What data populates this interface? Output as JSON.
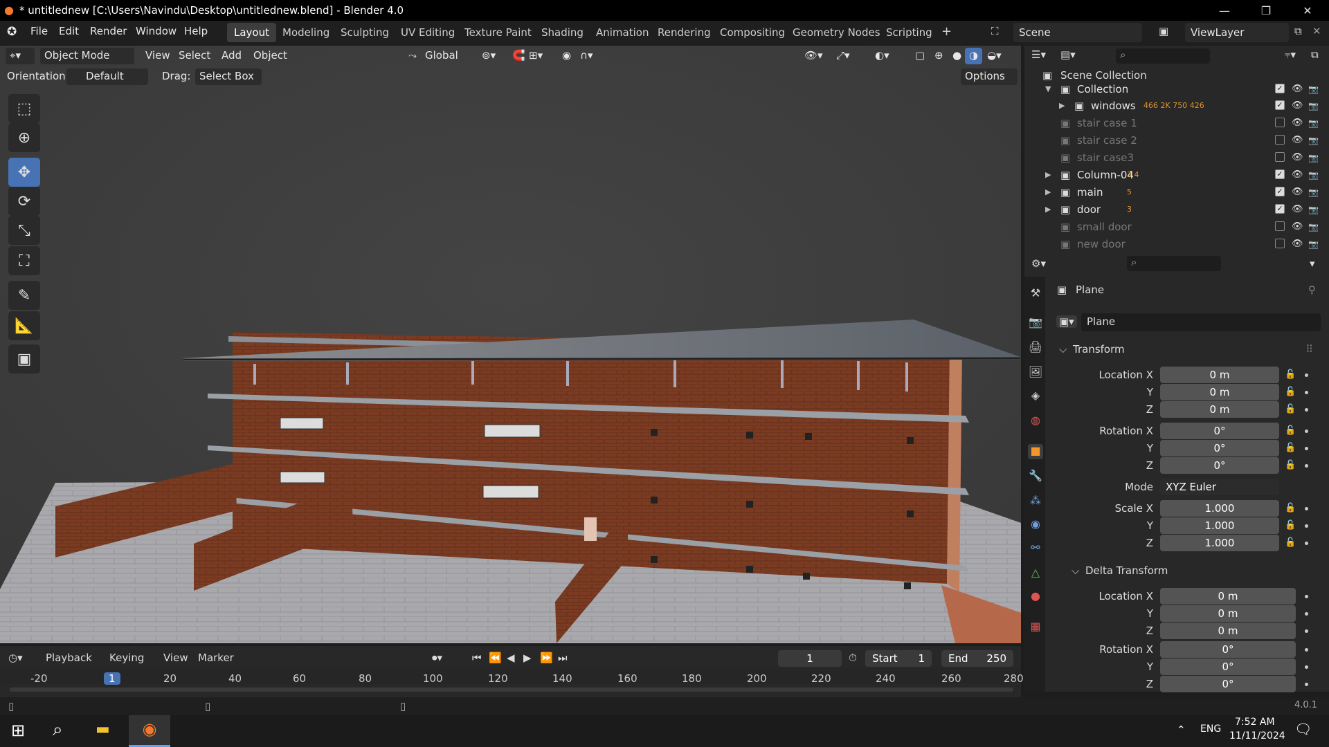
{
  "window": {
    "title": "* untitlednew [C:\\Users\\Navindu\\Desktop\\untitlednew.blend] - Blender 4.0",
    "minimize": "—",
    "maximize": "❐",
    "close": "✕"
  },
  "menu": {
    "file": "File",
    "edit": "Edit",
    "render": "Render",
    "window": "Window",
    "help": "Help"
  },
  "workspaces": [
    "Layout",
    "Modeling",
    "Sculpting",
    "UV Editing",
    "Texture Paint",
    "Shading",
    "Animation",
    "Rendering",
    "Compositing",
    "Geometry Nodes",
    "Scripting"
  ],
  "active_workspace": "Layout",
  "scene": {
    "name": "Scene",
    "view_layer": "ViewLayer"
  },
  "viewport_header": {
    "mode": "Object Mode",
    "view": "View",
    "select": "Select",
    "add": "Add",
    "object": "Object",
    "transform_orientation": "Global",
    "orientation_label": "Orientation:",
    "orientation_value": "Default",
    "drag_label": "Drag:",
    "drag_value": "Select Box",
    "options": "Options"
  },
  "outliner": {
    "root": "Scene Collection",
    "rows": [
      {
        "label": "Collection",
        "checked": true,
        "dim": false,
        "expanded": true
      },
      {
        "label": "windows",
        "checked": true,
        "dim": false,
        "badge": "466 2K 750 426"
      },
      {
        "label": "stair case 1",
        "checked": false,
        "dim": true
      },
      {
        "label": "stair case 2",
        "checked": false,
        "dim": true
      },
      {
        "label": "stair case3",
        "checked": false,
        "dim": true
      },
      {
        "label": "Column-04",
        "checked": true,
        "dim": false,
        "badge": "3 4"
      },
      {
        "label": "main",
        "checked": true,
        "dim": false,
        "badge": "5"
      },
      {
        "label": "door",
        "checked": true,
        "dim": false,
        "badge": "3"
      },
      {
        "label": "small door",
        "checked": false,
        "dim": true
      },
      {
        "label": "new door",
        "checked": false,
        "dim": true
      }
    ]
  },
  "properties": {
    "object_name": "Plane",
    "data_name": "Plane",
    "transform_header": "Transform",
    "location_label": "Location X",
    "y": "Y",
    "z": "Z",
    "rotation_label": "Rotation X",
    "mode_label": "Mode",
    "mode_value": "XYZ Euler",
    "scale_label": "Scale X",
    "location": [
      "0 m",
      "0 m",
      "0 m"
    ],
    "rotation": [
      "0°",
      "0°",
      "0°"
    ],
    "scale": [
      "1.000",
      "1.000",
      "1.000"
    ],
    "delta_header": "Delta Transform",
    "delta_location": [
      "0 m",
      "0 m",
      "0 m"
    ],
    "delta_rotation": [
      "0°",
      "0°",
      "0°"
    ]
  },
  "timeline": {
    "playback": "Playback",
    "keying": "Keying",
    "view": "View",
    "marker": "Marker",
    "current_frame": "1",
    "start_label": "Start",
    "start": "1",
    "end_label": "End",
    "end": "250",
    "ticks": [
      "-20",
      "1",
      "20",
      "40",
      "60",
      "80",
      "100",
      "120",
      "140",
      "160",
      "180",
      "200",
      "220",
      "240",
      "260",
      "280"
    ]
  },
  "status": {
    "version": "4.0.1"
  },
  "taskbar": {
    "lang": "ENG",
    "time": "7:52 AM",
    "date": "11/11/2024"
  }
}
